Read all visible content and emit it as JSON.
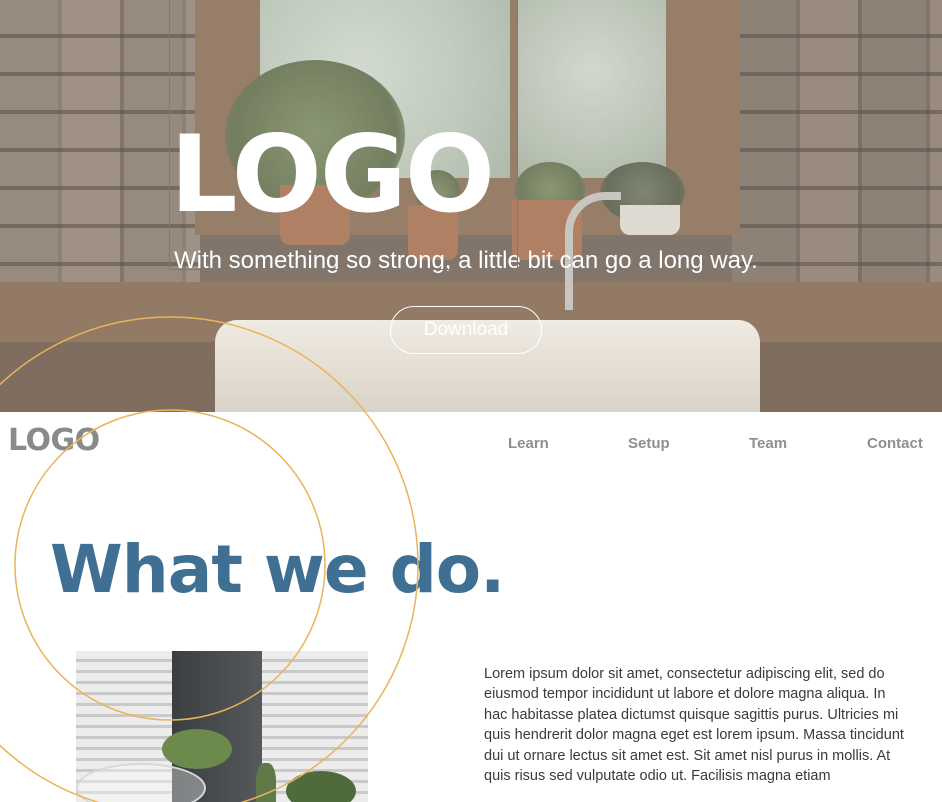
{
  "hero": {
    "logo": "LOGO",
    "tagline": "With something so strong, a little bit can go a long way.",
    "download_label": "Download"
  },
  "nav": {
    "logo": "LOGO",
    "links": [
      "Learn",
      "Setup",
      "Team",
      "Contact"
    ]
  },
  "section": {
    "heading": "What we do.",
    "body": "Lorem ipsum dolor sit amet, consectetur adipiscing elit, sed do eiusmod tempor incididunt ut labore et dolore magna aliqua. In hac habitasse platea dictumst quisque sagittis purus. Ultricies mi quis hendrerit dolor magna eget est lorem ipsum. Massa tincidunt dui ut ornare lectus sit amet est. Sit amet nisl purus in mollis. At quis risus sed vulputate odio ut. Facilisis magna etiam"
  },
  "colors": {
    "heading": "#3f6f93",
    "nav_text": "#8f8f8f",
    "selection": "#2b8fe0",
    "guide_circles": "#e8b45a"
  }
}
